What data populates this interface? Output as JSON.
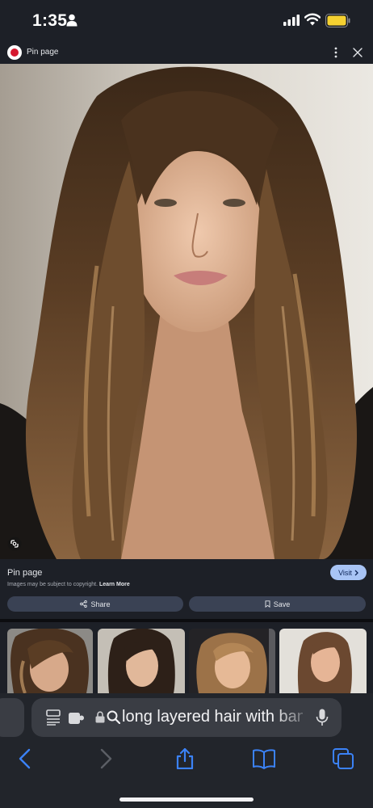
{
  "status_bar": {
    "time": "1:35",
    "icons": [
      "person-icon",
      "signal-icon",
      "wifi-icon",
      "battery-icon"
    ],
    "battery_color": "#f5d131"
  },
  "pin_header": {
    "title": "Pin page",
    "logo_color": "#d5182f",
    "icons": [
      "pinterest-logo-icon",
      "more-vertical-icon",
      "close-icon"
    ]
  },
  "main_image": {
    "icon": "google-lens-icon"
  },
  "info_panel": {
    "title": "Pin page",
    "copyright": "Images may be subject to copyright.",
    "learn_more": "Learn More",
    "visit_label": "Visit",
    "share_label": "Share",
    "save_label": "Save",
    "accent": "#a8c4f5"
  },
  "related": {
    "count_visible": 4
  },
  "address_bar": {
    "text": "long layered hair with bangs",
    "icons": [
      "reader-view-icon",
      "extension-icon",
      "lock-icon",
      "search-icon",
      "microphone-icon"
    ]
  },
  "bottom_nav": {
    "icons": [
      "back-icon",
      "forward-icon",
      "share-icon",
      "bookmarks-icon",
      "tabs-icon"
    ],
    "accent": "#3b82f6"
  }
}
